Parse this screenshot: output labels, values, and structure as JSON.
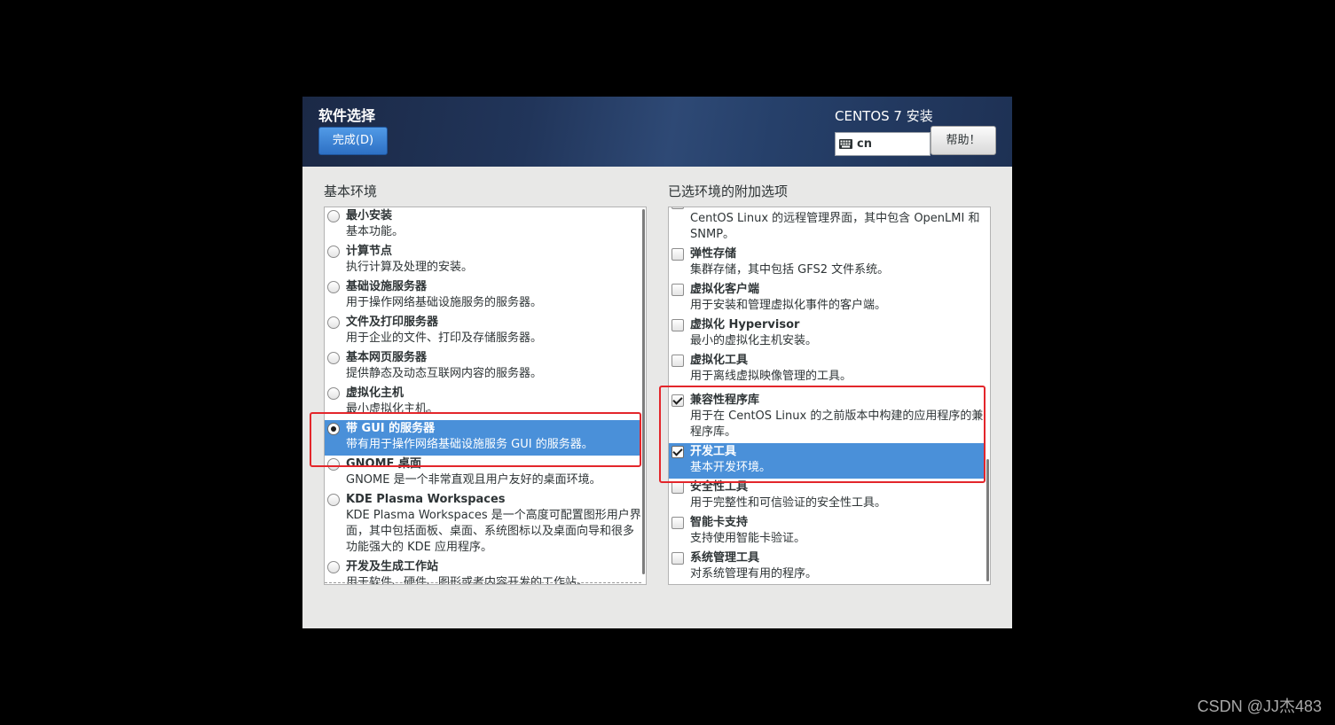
{
  "header": {
    "title": "软件选择",
    "done_label": "完成(D)",
    "product": "CENTOS 7 安装",
    "keyboard_icon": "keyboard-icon",
    "keyboard_layout": "cn",
    "help_label": "帮助！"
  },
  "left": {
    "label": "基本环境",
    "items": [
      {
        "title": "最小安装",
        "desc_lines": [
          "基本功能。"
        ],
        "selected": false
      },
      {
        "title": "计算节点",
        "desc_lines": [
          "执行计算及处理的安装。"
        ],
        "selected": false
      },
      {
        "title": "基础设施服务器",
        "desc_lines": [
          "用于操作网络基础设施服务的服务器。"
        ],
        "selected": false
      },
      {
        "title": "文件及打印服务器",
        "desc_lines": [
          "用于企业的文件、打印及存储服务器。"
        ],
        "selected": false
      },
      {
        "title": "基本网页服务器",
        "desc_lines": [
          "提供静态及动态互联网内容的服务器。"
        ],
        "selected": false
      },
      {
        "title": "虚拟化主机",
        "desc_lines": [
          "最小虚拟化主机。"
        ],
        "selected": false
      },
      {
        "title": "带 GUI 的服务器",
        "desc_lines": [
          "带有用于操作网络基础设施服务 GUI 的服务器。"
        ],
        "selected": true
      },
      {
        "title": "GNOME 桌面",
        "desc_lines": [
          "GNOME 是一个非常直观且用户友好的桌面环境。"
        ],
        "selected": false
      },
      {
        "title": "KDE Plasma Workspaces",
        "desc_lines": [
          "KDE Plasma Workspaces 是一个高度可配置图形用户界",
          "面，其中包括面板、桌面、系统图标以及桌面向导和很多",
          "功能强大的 KDE 应用程序。"
        ],
        "selected": false
      },
      {
        "title": "开发及生成工作站",
        "desc_lines": [
          "用于软件、硬件、图形或者内容开发的工作站。"
        ],
        "selected": false
      }
    ]
  },
  "right": {
    "label": "已选环境的附加选项",
    "items": [
      {
        "desc_lines": [
          "CentOS Linux 的远程管理界面，其中包含 OpenLMI 和",
          "SNMP。"
        ],
        "checked": false,
        "highlighted": false
      },
      {
        "title": "弹性存储",
        "desc_lines": [
          "集群存储，其中包括 GFS2 文件系统。"
        ],
        "checked": false,
        "highlighted": false
      },
      {
        "title": "虚拟化客户端",
        "desc_lines": [
          "用于安装和管理虚拟化事件的客户端。"
        ],
        "checked": false,
        "highlighted": false
      },
      {
        "title": "虚拟化 Hypervisor",
        "desc_lines": [
          "最小的虚拟化主机安装。"
        ],
        "checked": false,
        "highlighted": false
      },
      {
        "title": "虚拟化工具",
        "desc_lines": [
          "用于离线虚拟映像管理的工具。"
        ],
        "checked": false,
        "highlighted": false
      },
      {
        "title": "兼容性程序库",
        "desc_lines": [
          "用于在 CentOS Linux 的之前版本中构建的应用程序的兼容",
          "程序库。"
        ],
        "checked": true,
        "highlighted": false
      },
      {
        "title": "开发工具",
        "desc_lines": [
          "基本开发环境。"
        ],
        "checked": true,
        "highlighted": true
      },
      {
        "title": "安全性工具",
        "desc_lines": [
          "用于完整性和可信验证的安全性工具。"
        ],
        "checked": false,
        "highlighted": false
      },
      {
        "title": "智能卡支持",
        "desc_lines": [
          "支持使用智能卡验证。"
        ],
        "checked": false,
        "highlighted": false
      },
      {
        "title": "系统管理工具",
        "desc_lines": [
          "对系统管理有用的程序。"
        ],
        "checked": false,
        "highlighted": false
      }
    ]
  },
  "watermark": "CSDN @JJ杰483",
  "colors": {
    "page_background": "#000000",
    "panel": "#e8e8e7",
    "header": "#22365c",
    "done_button": "#3b82d6",
    "selection": "#4a90d9",
    "annotation": "#e3262b"
  }
}
